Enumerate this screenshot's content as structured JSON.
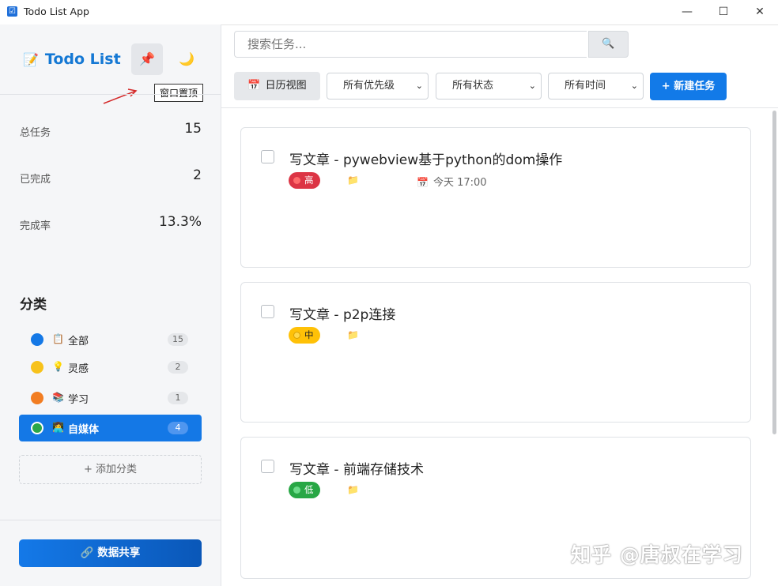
{
  "window": {
    "title": "Todo List App",
    "minimize": "—",
    "maximize": "☐",
    "close": "✕",
    "app_icon": "☑"
  },
  "sidebar": {
    "brand": "Todo List",
    "brand_icon": "📝",
    "pin_icon": "📌",
    "theme_icon": "🌙",
    "pin_tooltip": "窗口置顶",
    "stats": [
      {
        "label": "总任务",
        "value": "15"
      },
      {
        "label": "已完成",
        "value": "2"
      },
      {
        "label": "完成率",
        "value": "13.3%"
      }
    ],
    "categories_title": "分类",
    "categories": [
      {
        "emoji": "📋",
        "label": "全部",
        "count": "15",
        "color": "#1478e6",
        "active": false
      },
      {
        "emoji": "💡",
        "label": "灵感",
        "count": "2",
        "color": "#f7c21b",
        "active": false
      },
      {
        "emoji": "📚",
        "label": "学习",
        "count": "1",
        "color": "#f27d22",
        "active": false
      },
      {
        "emoji": "👩‍💻",
        "label": "自媒体",
        "count": "4",
        "color": "#2aa748",
        "active": true
      }
    ],
    "add_category": "+ 添加分类",
    "share_label": "🔗 数据共享"
  },
  "toolbar": {
    "search_placeholder": "搜索任务...",
    "search_icon": "🔍",
    "calendar_label": "日历视图",
    "calendar_icon": "📅",
    "filters": [
      "所有优先级",
      "所有状态",
      "所有时间"
    ],
    "new_task": "+ 新建任务"
  },
  "tasks": [
    {
      "title": "写文章 - pywebview基于python的dom操作",
      "priority": "高",
      "priority_color": "#dc3545",
      "due": "今天 17:00",
      "due_icon": "📅",
      "folder_icon": "📁"
    },
    {
      "title": "写文章 - p2p连接",
      "priority": "中",
      "priority_color": "#ffc107",
      "due": "",
      "folder_icon": "📁"
    },
    {
      "title": "写文章 - 前端存储技术",
      "priority": "低",
      "priority_color": "#28a745",
      "due": "",
      "folder_icon": "📁"
    }
  ],
  "watermark": "知乎 @唐叔在学习"
}
